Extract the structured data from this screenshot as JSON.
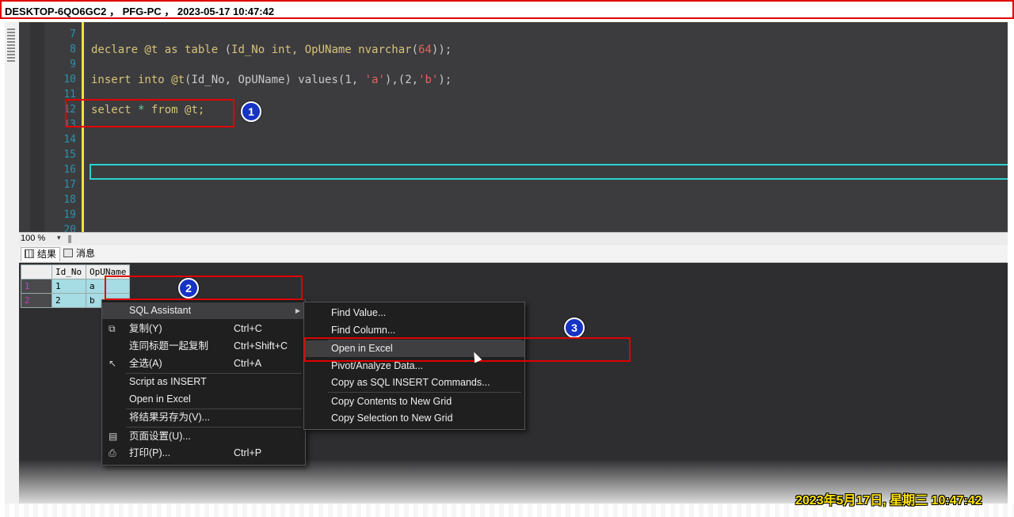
{
  "header": {
    "title": "DESKTOP-6QO6GC2 ， PFG-PC ， 2023-05-17  10:47:42"
  },
  "editor": {
    "line_numbers": [
      "7",
      "8",
      "9",
      "10",
      "11",
      "12",
      "13",
      "14",
      "15",
      "16",
      "17",
      "18",
      "19",
      "20"
    ],
    "line8": {
      "kw": "declare @t as table ",
      "p1": "(",
      "mid": "Id_No int, OpUName nvarchar",
      "p2": "(",
      "num": "64",
      "end": "));"
    },
    "line10": {
      "a": "insert into @t",
      "b": "(Id_No, OpUName) values",
      "c": "(1, ",
      "d": "'a'",
      "e": "),(2,",
      "f": "'b'",
      "g": ");"
    },
    "line12": {
      "a": "select ",
      "star": "*",
      "b": " from @t;"
    }
  },
  "annotations": {
    "b1": "1",
    "b2": "2",
    "b3": "3"
  },
  "zoom": {
    "value": "100 %",
    "arrow": "▾"
  },
  "result_tabs": {
    "results": "结果",
    "messages": "消息"
  },
  "grid": {
    "columns": [
      "Id_No",
      "OpUName"
    ],
    "rows": [
      {
        "num": "1",
        "id": "1",
        "name": "a"
      },
      {
        "num": "2",
        "id": "2",
        "name": "b"
      }
    ]
  },
  "context_menu": {
    "sql_assistant": "SQL Assistant",
    "copy": "复制(Y)",
    "copy_sc": "Ctrl+C",
    "copy_headers": "连同标题一起复制",
    "copy_headers_sc": "Ctrl+Shift+C",
    "select_all": "全选(A)",
    "select_all_sc": "Ctrl+A",
    "script_insert": "Script as INSERT",
    "open_excel": "Open in Excel",
    "save_as": "将结果另存为(V)...",
    "page_setup": "页面设置(U)...",
    "print": "打印(P)...",
    "print_sc": "Ctrl+P"
  },
  "submenu": {
    "find_value": "Find Value...",
    "find_column": "Find Column...",
    "open_excel": "Open in Excel",
    "pivot": "Pivot/Analyze Data...",
    "copy_sql_insert": "Copy as SQL INSERT Commands...",
    "copy_contents": "Copy Contents to New Grid",
    "copy_selection": "Copy Selection to New Grid"
  },
  "datestamp": "2023年5月17日, 星期三  10:47:42"
}
